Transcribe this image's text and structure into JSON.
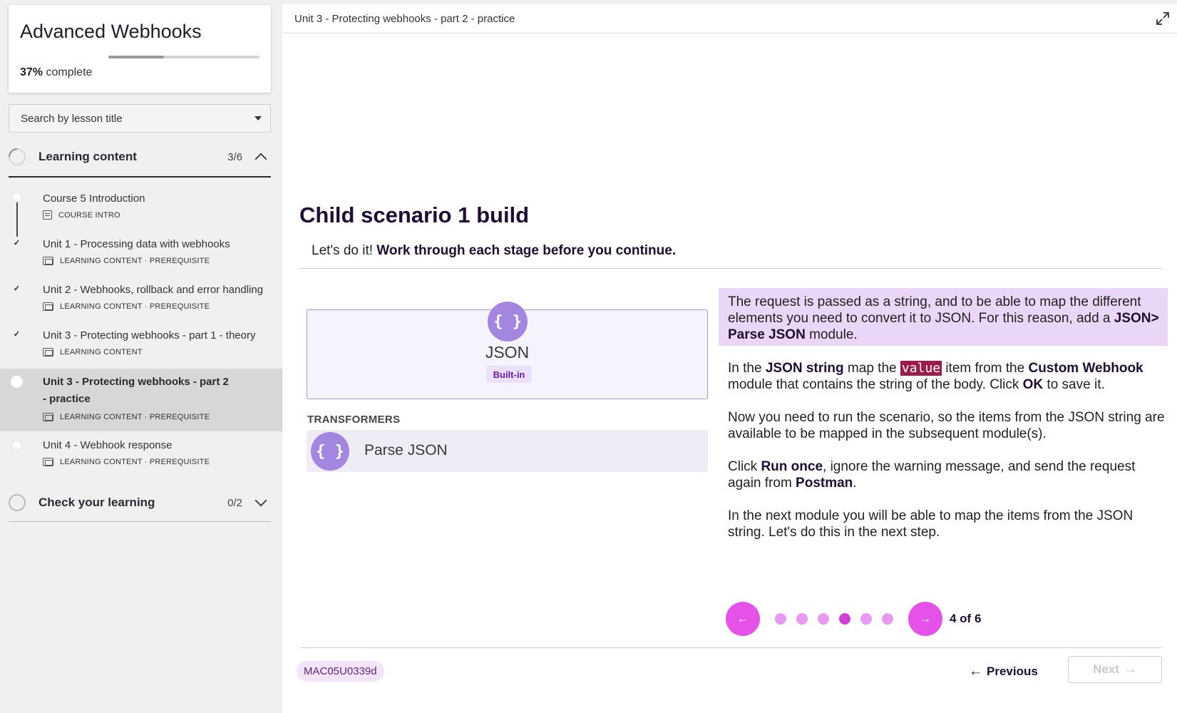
{
  "sidebar": {
    "course_title": "Advanced Webhooks",
    "progress_percent": 37,
    "progress_value": "37%",
    "progress_suffix": "complete",
    "search_placeholder": "Search by lesson title",
    "sections": [
      {
        "label": "Learning content",
        "count": "3/6",
        "expanded": true,
        "lessons": [
          {
            "title": "Course 5 Introduction",
            "meta": "COURSE INTRO",
            "status": "not-started"
          },
          {
            "title": "Unit 1 - Processing data with webhooks",
            "meta": "LEARNING CONTENT · PREREQUISITE",
            "status": "complete"
          },
          {
            "title": "Unit 2 - Webhooks, rollback and error handling",
            "meta": "LEARNING CONTENT · PREREQUISITE",
            "status": "complete"
          },
          {
            "title": "Unit 3 - Protecting webhooks - part 1 - theory",
            "meta": "LEARNING CONTENT",
            "status": "complete"
          },
          {
            "title": "Unit 3 - Protecting webhooks - part 2 - practice",
            "meta": "LEARNING CONTENT · PREREQUISITE",
            "status": "current"
          },
          {
            "title": "Unit 4 - Webhook response",
            "meta": "LEARNING CONTENT · PREREQUISITE",
            "status": "not-started"
          }
        ]
      },
      {
        "label": "Check your learning",
        "count": "0/2",
        "expanded": false
      }
    ],
    "check_mark": "✓"
  },
  "main": {
    "breadcrumb": "Unit 3 - Protecting webhooks - part 2 - practice",
    "heading": "Child scenario 1 build",
    "intro_plain": "Let's do it! ",
    "intro_bold": "Work through each stage before you continue.",
    "module": {
      "icon_glyph": "{ }",
      "name": "JSON",
      "badge": "Built-in",
      "group_label": "TRANSFORMERS",
      "action_label": "Parse JSON"
    },
    "paragraphs": {
      "p1_a": "The request is passed as a string, and to be able to map the different elements you need to convert it to JSON. For this reason, add a ",
      "p1_b": "JSON> Parse JSON",
      "p1_c": " module.",
      "p2_a": "In the ",
      "p2_b": "JSON string",
      "p2_c": " map the ",
      "p2_code": "value",
      "p2_d": " item from the ",
      "p2_e": "Custom Webhook",
      "p2_f": " module that contains the string of the body. Click ",
      "p2_g": "OK",
      "p2_h": " to save it.",
      "p3": "Now you need to run the scenario, so the items from the JSON string are available to be mapped in the subsequent module(s).",
      "p4_a": "Click ",
      "p4_b": "Run once",
      "p4_c": ", ignore the warning message, and send the request again from ",
      "p4_d": "Postman",
      "p4_e": ".",
      "p5": "In the next module you will be able to map the items from the JSON string. Let's do this in the next step."
    },
    "pager": {
      "prev_glyph": "←",
      "next_glyph": "→",
      "total": 6,
      "current": 4,
      "label": "4 of 6"
    },
    "footer": {
      "code": "MAC05U0339d",
      "previous_label": "Previous",
      "next_label": "Next",
      "prev_arrow": "←",
      "next_arrow": "→"
    }
  },
  "colors": {
    "accent": "#e452e8",
    "accent_dark": "#d03fd6",
    "module_purple": "#a386e0",
    "highlight_bg": "#ead6f7",
    "code_bg": "#9b1b4a",
    "heading": "#1f0d33"
  },
  "icons": {
    "expand": "expand-arrows-icon",
    "caret": "caret-down-icon",
    "chevron_up": "chevron-up-icon",
    "chevron_down": "chevron-down-icon",
    "lesson_doc": "document-icon",
    "lesson_slide": "slides-icon"
  }
}
